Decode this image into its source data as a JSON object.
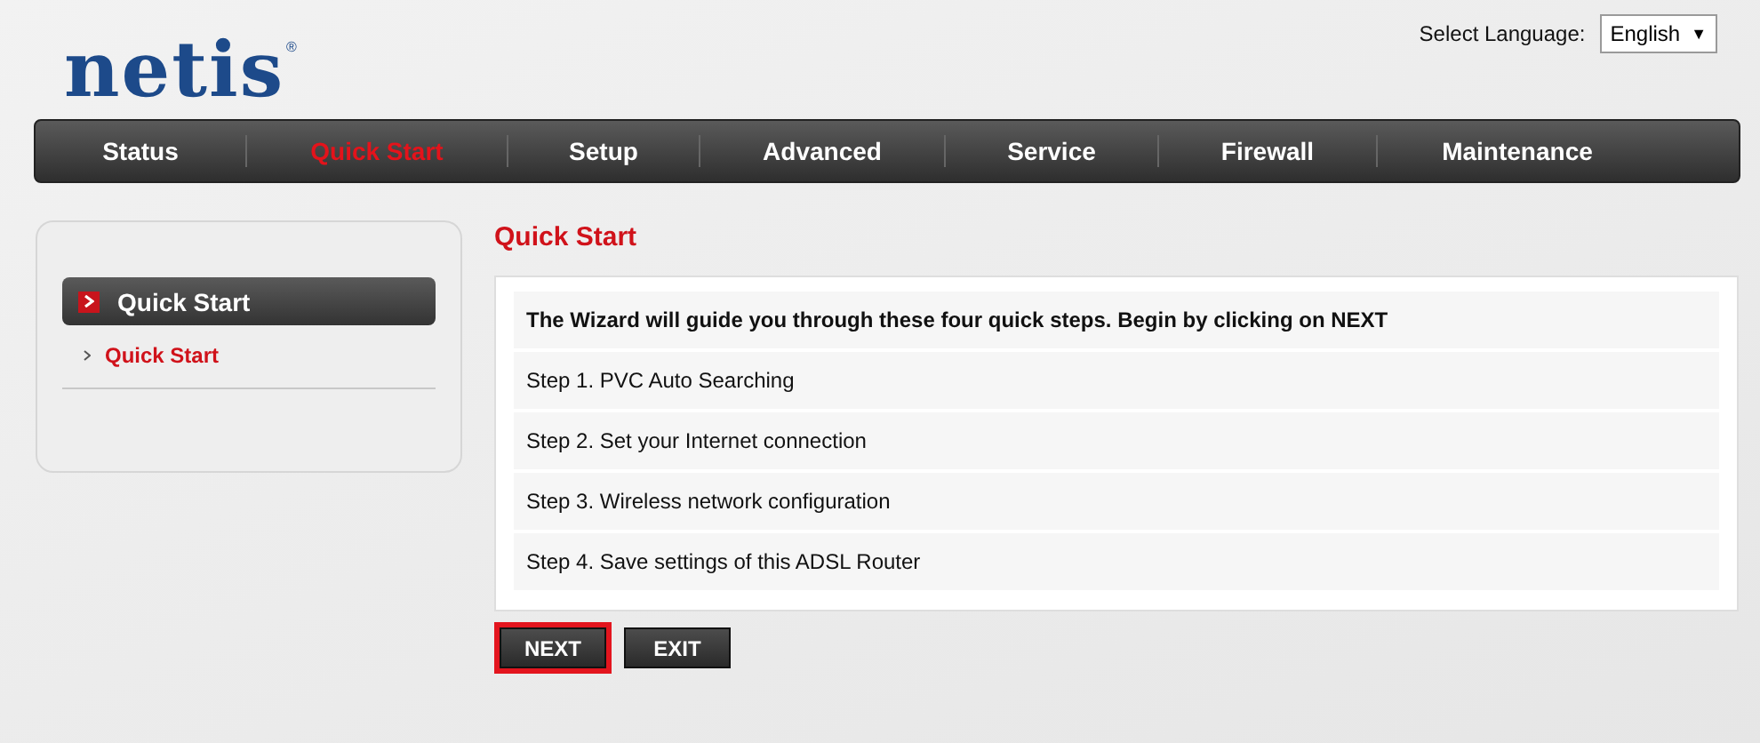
{
  "header": {
    "logo": "netis",
    "logo_mark": "®",
    "language_label": "Select Language:",
    "language": "English",
    "language_caret": "▼"
  },
  "nav": [
    {
      "label": "Status",
      "selected": false
    },
    {
      "label": "Quick Start",
      "selected": true
    },
    {
      "label": "Setup",
      "selected": false
    },
    {
      "label": "Advanced",
      "selected": false
    },
    {
      "label": "Service",
      "selected": false
    },
    {
      "label": "Firewall",
      "selected": false
    },
    {
      "label": "Maintenance",
      "selected": false
    }
  ],
  "sidebar": {
    "section": "Quick Start",
    "items": [
      {
        "label": "Quick Start",
        "selected": true
      }
    ]
  },
  "content": {
    "title": "Quick Start",
    "rows": [
      {
        "text": "The Wizard will guide you through these four quick steps. Begin by clicking on NEXT",
        "kind": "intro"
      },
      {
        "text": "Step 1. PVC Auto Searching",
        "kind": "step"
      },
      {
        "text": "Step 2. Set your Internet connection",
        "kind": "step"
      },
      {
        "text": "Step 3. Wireless network configuration",
        "kind": "step"
      },
      {
        "text": "Step 4. Save settings of this ADSL Router",
        "kind": "step"
      }
    ],
    "buttons": [
      {
        "label": "NEXT",
        "highlighted": true
      },
      {
        "label": "EXIT",
        "highlighted": false
      }
    ]
  }
}
